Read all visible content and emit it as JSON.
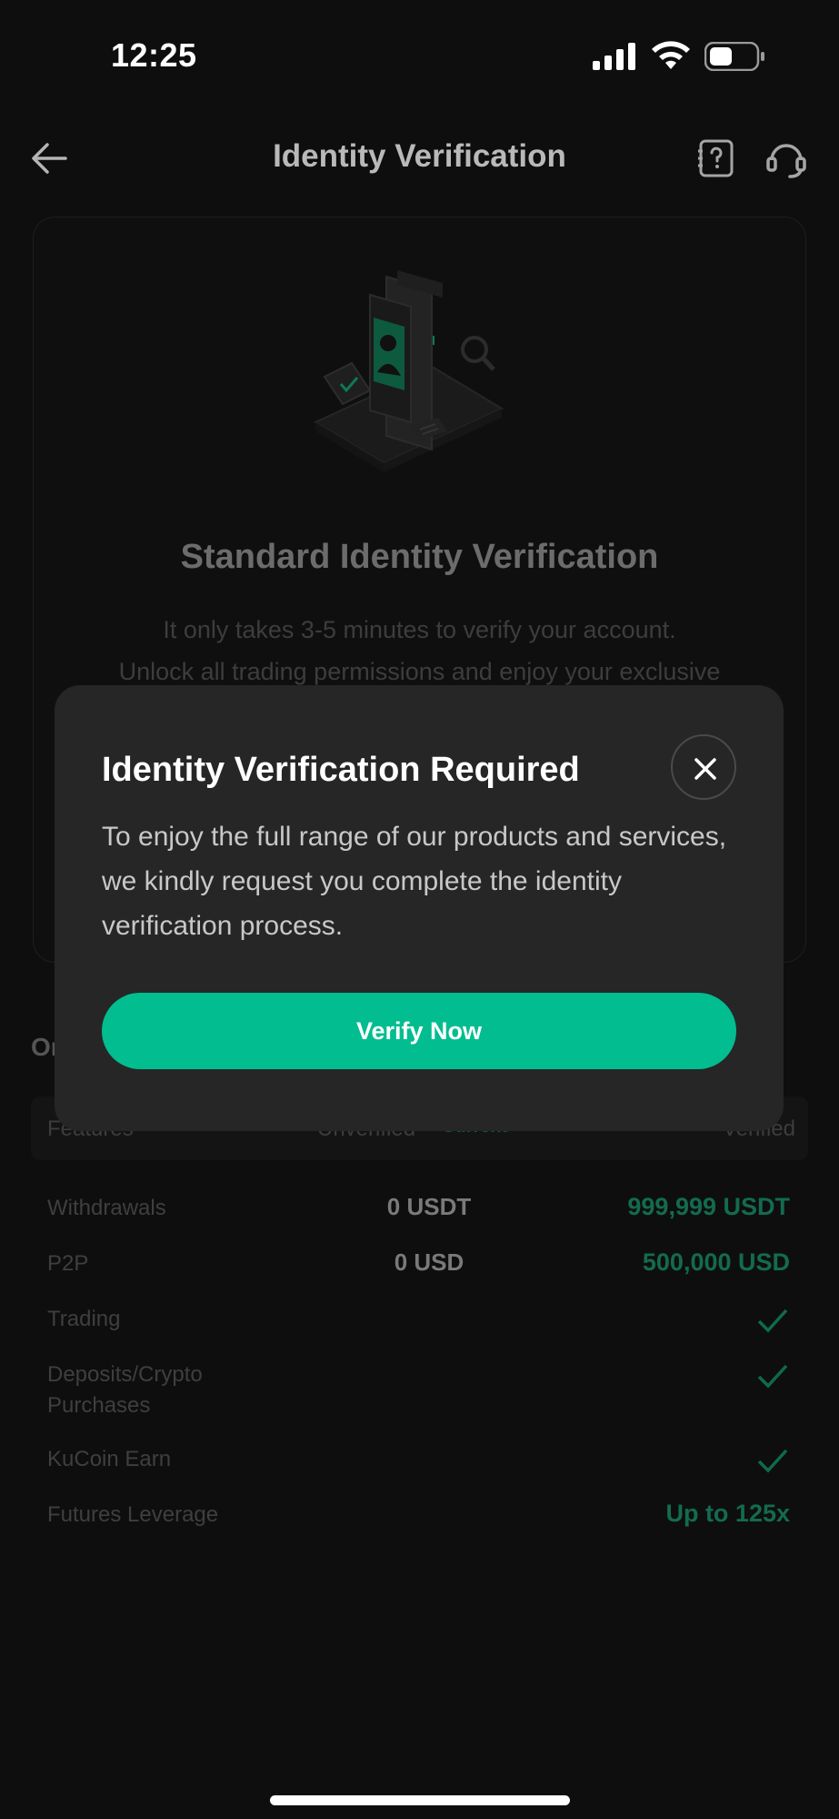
{
  "status_bar": {
    "time": "12:25"
  },
  "header": {
    "title": "Identity Verification"
  },
  "hero": {
    "title": "Standard Identity Verification",
    "desc_line1": "It only takes 3-5 minutes to verify your account.",
    "desc_line2": "Unlock all trading permissions and enjoy your exclusive"
  },
  "table": {
    "section_title_partial": "Or",
    "headers": {
      "features": "Features",
      "unverified": "Unverified",
      "current": "Current",
      "verified": "Verified"
    },
    "rows": [
      {
        "label": "Withdrawals",
        "unverified": "0 USDT",
        "verified": "999,999 USDT"
      },
      {
        "label": "P2P",
        "unverified": "0 USD",
        "verified": "500,000 USD"
      },
      {
        "label": "Trading",
        "verified_icon": "check-icon"
      },
      {
        "label": "Deposits/Crypto Purchases",
        "verified_icon": "check-icon"
      },
      {
        "label": "KuCoin Earn",
        "verified_icon": "check-icon"
      },
      {
        "label": "Futures Leverage",
        "verified": "Up to 125x"
      }
    ]
  },
  "modal": {
    "title": "Identity Verification Required",
    "body": "To enjoy the full range of our products and services, we kindly request you complete the identity verification process.",
    "button": "Verify Now"
  },
  "colors": {
    "accent": "#02bd8f",
    "modal_bg": "#262626",
    "page_bg": "#0e0e0e"
  }
}
